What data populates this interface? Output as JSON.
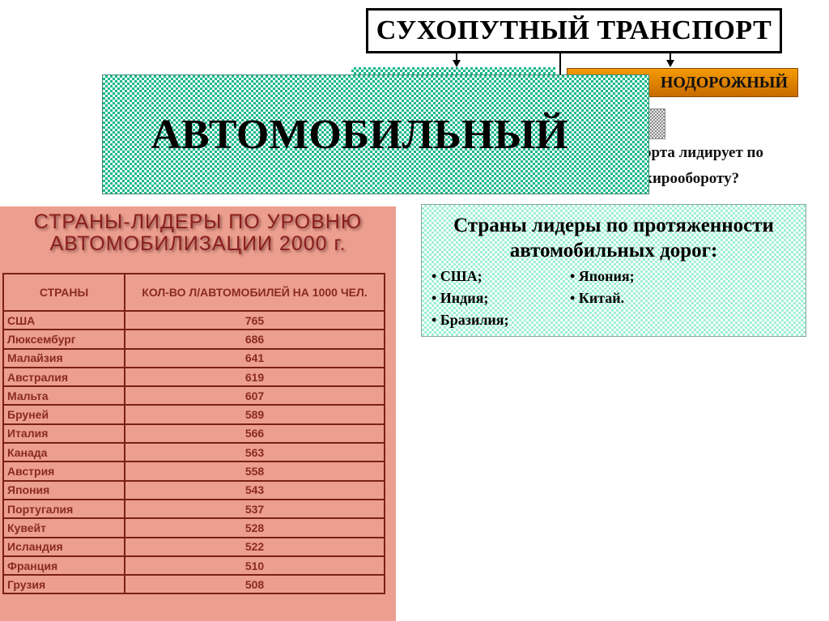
{
  "header": {
    "title": "СУХОПУТНЫЙ ТРАНСПОРТ"
  },
  "branches": {
    "auto_label": "АВТОМОБИЛЬНЫЙ",
    "rail_label_visible": "НОДОРОЖНЫЙ"
  },
  "question": {
    "line1_visible": "орта лидирует по",
    "line2_visible": "кирообороту?"
  },
  "colors": {
    "auto_box": "#1ab88a",
    "rail_box": "#f59b00",
    "table_panel": "#ec9f8e",
    "table_text": "#8a2a22",
    "roads_box": "#9ff0d4"
  },
  "motorization_table": {
    "title_line1": "СТРАНЫ-ЛИДЕРЫ ПО УРОВНЮ",
    "title_line2": "АВТОМОБИЛИЗАЦИИ  2000 г.",
    "headers": [
      "СТРАНЫ",
      "КОЛ-ВО Л/АВТОМОБИЛЕЙ НА 1000 ЧЕЛ."
    ],
    "rows": [
      {
        "country": "США",
        "value": "765"
      },
      {
        "country": "Люксембург",
        "value": "686"
      },
      {
        "country": "Малайзия",
        "value": "641"
      },
      {
        "country": "Австралия",
        "value": "619"
      },
      {
        "country": "Мальта",
        "value": "607"
      },
      {
        "country": "Бруней",
        "value": "589"
      },
      {
        "country": "Италия",
        "value": "566"
      },
      {
        "country": "Канада",
        "value": "563"
      },
      {
        "country": "Австрия",
        "value": "558"
      },
      {
        "country": "Япония",
        "value": "543"
      },
      {
        "country": "Португалия",
        "value": "537"
      },
      {
        "country": "Кувейт",
        "value": "528"
      },
      {
        "country": "Исландия",
        "value": "522"
      },
      {
        "country": "Франция",
        "value": "510"
      },
      {
        "country": "Грузия",
        "value": "508"
      }
    ]
  },
  "roads": {
    "title_line1": "Страны лидеры по протяженности",
    "title_line2": "автомобильных дорог:",
    "col1": [
      "• США;",
      "• Индия;",
      "• Бразилия;"
    ],
    "col2": [
      "• Япония;",
      "• Китай."
    ]
  }
}
